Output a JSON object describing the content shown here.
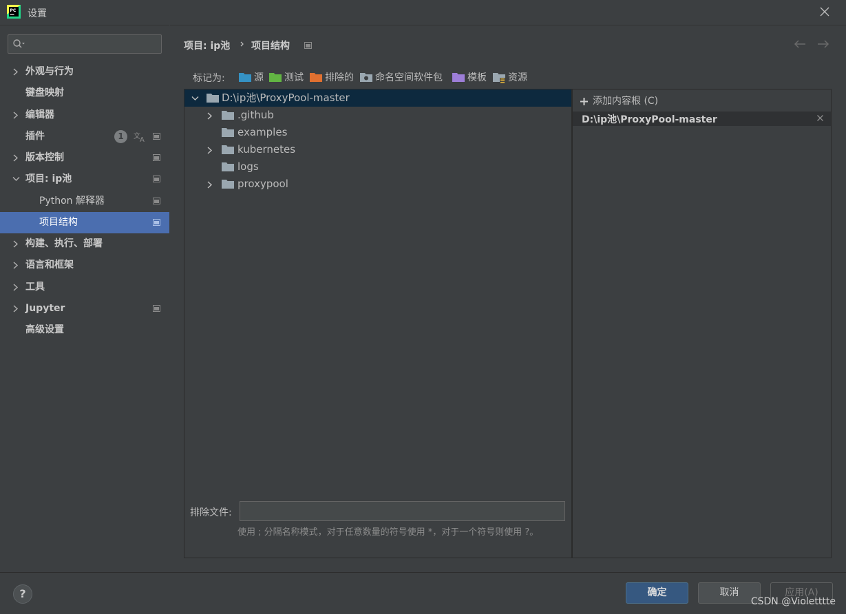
{
  "window": {
    "title": "设置"
  },
  "search": {
    "placeholder": ""
  },
  "sidebar": {
    "items": [
      {
        "label": "外观与行为"
      },
      {
        "label": "键盘映射"
      },
      {
        "label": "编辑器"
      },
      {
        "label": "插件",
        "badge": "1"
      },
      {
        "label": "版本控制"
      },
      {
        "label": "项目: ip池"
      },
      {
        "label": "Python 解释器"
      },
      {
        "label": "项目结构"
      },
      {
        "label": "构建、执行、部署"
      },
      {
        "label": "语言和框架"
      },
      {
        "label": "工具"
      },
      {
        "label": "Jupyter"
      },
      {
        "label": "高级设置"
      }
    ]
  },
  "breadcrumb": {
    "parent": "项目: ip池",
    "current": "项目结构"
  },
  "mark_as": {
    "label": "标记为:",
    "items": [
      {
        "label": "源",
        "color": "#3592c4"
      },
      {
        "label": "测试",
        "color": "#62b543"
      },
      {
        "label": "排除的",
        "color": "#e07030"
      },
      {
        "label": "命名空间软件包",
        "color": "#9aa7b0"
      },
      {
        "label": "模板",
        "color": "#9d7ed8"
      },
      {
        "label": "资源",
        "color": "#9aa7b0"
      }
    ]
  },
  "tree": {
    "root": "D:\\ip池\\ProxyPool-master",
    "children": [
      {
        "label": ".github"
      },
      {
        "label": "examples"
      },
      {
        "label": "kubernetes"
      },
      {
        "label": "logs"
      },
      {
        "label": "proxypool"
      }
    ]
  },
  "exclude": {
    "label": "排除文件:",
    "value": "",
    "hint": "使用 ; 分隔名称模式，对于任意数量的符号使用 *，对于一个符号则使用 ?。"
  },
  "roots": {
    "add_label": "添加内容根 (C)",
    "entries": [
      "D:\\ip池\\ProxyPool-master"
    ]
  },
  "footer": {
    "help": "?",
    "ok": "确定",
    "cancel": "取消",
    "apply": "应用(A)",
    "watermark": "CSDN @Violetttte"
  }
}
